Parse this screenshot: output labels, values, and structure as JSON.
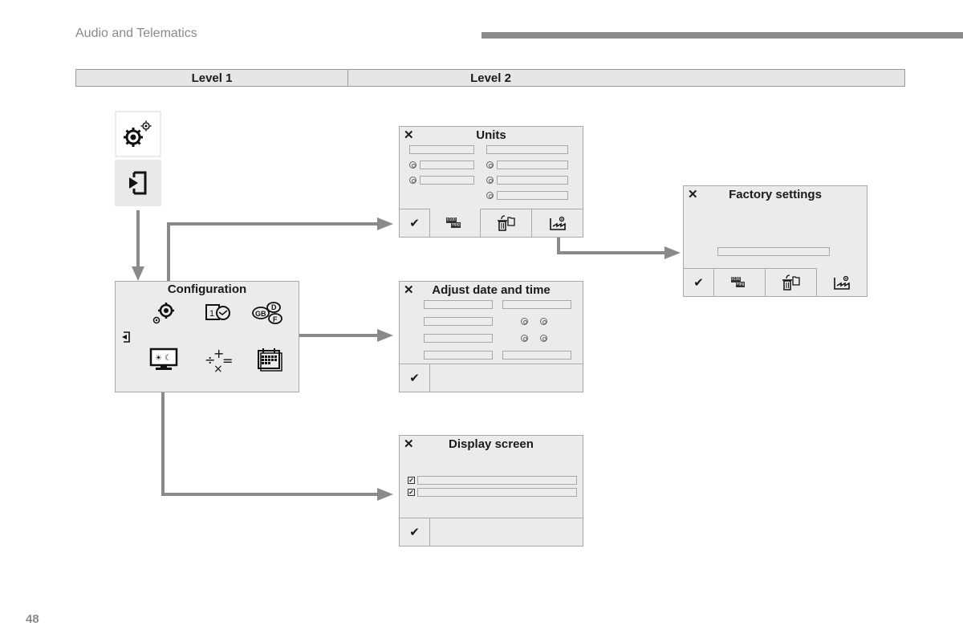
{
  "header": {
    "section_title": "Audio and Telematics",
    "page_number": "48"
  },
  "levels": {
    "level1": "Level 1",
    "level2": "Level 2"
  },
  "level1": {
    "settings_icon": "settings-gears-icon",
    "entry_icon": "enter-menu-icon"
  },
  "configuration": {
    "title": "Configuration",
    "icons": [
      "system-settings-icon",
      "date-time-icon",
      "languages-icon",
      "back-icon",
      "display-screen-icon",
      "units-calculator-icon",
      "calendar-icon"
    ],
    "language_labels": [
      "GB",
      "D",
      "F"
    ],
    "date_label": "1"
  },
  "panels": {
    "units": {
      "title": "Units",
      "close": "✕",
      "footer": [
        "confirm-icon",
        "units-mpg-icon",
        "delete-data-icon",
        "factory-settings-icon"
      ],
      "mpg_labels": [
        "l/100",
        "mpg"
      ]
    },
    "factory_settings": {
      "title": "Factory settings",
      "close": "✕",
      "footer": [
        "confirm-icon",
        "units-mpg-icon",
        "delete-data-icon",
        "factory-settings-icon"
      ],
      "mpg_labels": [
        "l/100",
        "mpg"
      ]
    },
    "date_time": {
      "title": "Adjust date and time",
      "close": "✕",
      "footer": [
        "confirm-icon"
      ]
    },
    "display_screen": {
      "title": "Display screen",
      "close": "✕",
      "footer": [
        "confirm-icon"
      ]
    }
  },
  "glyphs": {
    "check": "✔",
    "checkbox": "✓"
  }
}
